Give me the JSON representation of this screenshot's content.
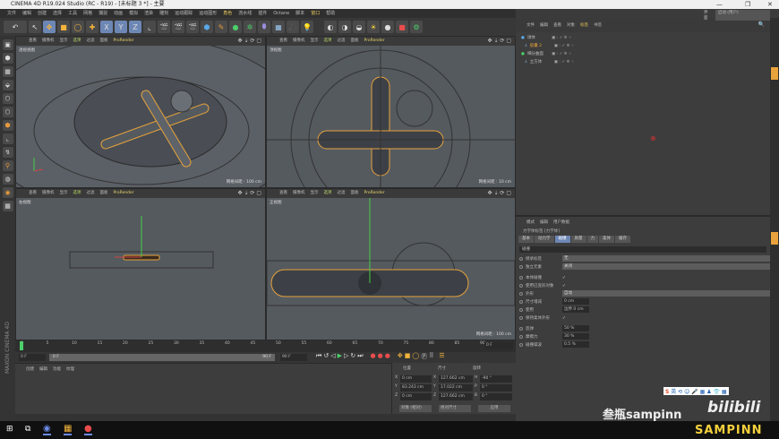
{
  "window": {
    "title": "CINEMA 4D R19.024 Studio (RC - R19) - [未标题 3 *] - 主要",
    "min": "—",
    "max": "❐",
    "close": "✕"
  },
  "menu": [
    "文件",
    "编辑",
    "创建",
    "选择",
    "工具",
    "网格",
    "捕捉",
    "动画",
    "模拟",
    "渲染",
    "雕刻",
    "运动跟踪",
    "运动图形",
    "角色",
    "流水线",
    "插件",
    "Octane",
    "脚本",
    "窗口",
    "帮助"
  ],
  "layout": {
    "label": "界面",
    "value": "启动 (用户)"
  },
  "viewport_menu": [
    "查看",
    "摄像机",
    "显示",
    "选项",
    "过滤",
    "面板",
    "ProRender"
  ],
  "viewports": [
    {
      "name": "透视视图",
      "grid": "网格间距 : 100 cm"
    },
    {
      "name": "顶视图",
      "grid": "网格间距 : 10 cm"
    },
    {
      "name": "右视图",
      "grid": ""
    },
    {
      "name": "正视图",
      "grid": "网格间距 : 100 cm"
    }
  ],
  "object_manager": {
    "tabs": [
      "文件",
      "编辑",
      "查看",
      "对象",
      "标签",
      "书签"
    ],
    "objects": [
      {
        "name": "球体",
        "selected": false
      },
      {
        "name": "胶囊 2",
        "selected": true
      },
      {
        "name": "细分曲面",
        "selected": false
      },
      {
        "name": "立方体",
        "selected": false
      }
    ]
  },
  "attributes": {
    "tabs": [
      "模式",
      "编辑",
      "用户数据"
    ],
    "title": "力学体标签 [力学体]",
    "subtabs": [
      "基本",
      "动力学",
      "碰撞",
      "质量",
      "力",
      "柔体",
      "缓存"
    ],
    "active_subtab": "碰撞",
    "section": "碰撞",
    "fields": [
      {
        "label": "继承标签",
        "type": "dropdown",
        "value": "无"
      },
      {
        "label": "独立元素",
        "type": "dropdown",
        "value": "关闭"
      },
      {
        "label": "本体碰撞",
        "type": "check",
        "value": "✓"
      },
      {
        "label": "使用已变形对象",
        "type": "check",
        "value": "✓"
      },
      {
        "label": "外形",
        "type": "dropdown",
        "value": "自动"
      },
      {
        "label": "尺寸增减",
        "type": "number",
        "value": "0 cm"
      },
      {
        "label": "使用",
        "type": "number",
        "value": "边界  0 cm"
      },
      {
        "label": "保持柔体外形",
        "type": "check",
        "value": "✓"
      },
      {
        "label": "反弹",
        "type": "number",
        "value": "50 %"
      },
      {
        "label": "摩擦力",
        "type": "number",
        "value": "30 %"
      },
      {
        "label": "碰撞噪波",
        "type": "number",
        "value": "0.5 %"
      }
    ]
  },
  "timeline": {
    "ticks": [
      "0",
      "5",
      "10",
      "15",
      "20",
      "25",
      "30",
      "35",
      "40",
      "45",
      "50",
      "55",
      "60",
      "65",
      "70",
      "75",
      "80",
      "85",
      "90"
    ],
    "current": "0 F",
    "start": "0 F",
    "range_start": "0 F",
    "range_end": "90 F",
    "end": "90 F"
  },
  "material_manager": {
    "tabs": [
      "创建",
      "编辑",
      "功能",
      "纹理"
    ]
  },
  "coordinates": {
    "headers": [
      "位置",
      "尺寸",
      "旋转"
    ],
    "rows": [
      {
        "axis": "X",
        "pos": "0 cm",
        "size_axis": "X",
        "size": "127.662 cm",
        "rot_axis": "H",
        "rot": "-90 °"
      },
      {
        "axis": "Y",
        "pos": "83.243 cm",
        "size_axis": "Y",
        "size": "17.022 cm",
        "rot_axis": "P",
        "rot": "0 °"
      },
      {
        "axis": "Z",
        "pos": "0 cm",
        "size_axis": "Z",
        "size": "127.662 cm",
        "rot_axis": "B",
        "rot": "0 °"
      }
    ],
    "mode": "对象 (相对)",
    "size_mode": "绝对尺寸",
    "apply": "应用"
  },
  "watermark": {
    "text": "叁瓶sampinn",
    "logo": "bilibili",
    "brand": "SAMPINN"
  },
  "brand_side": "MAXON CINEMA 4D",
  "colors": {
    "accent": "#6d87b5",
    "selection": "#e8a33c",
    "highlight": "#e8c85c"
  }
}
